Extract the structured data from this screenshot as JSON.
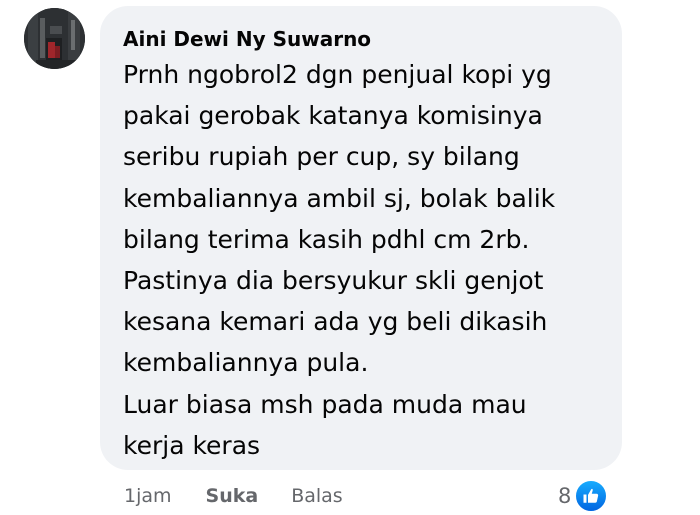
{
  "comment": {
    "author": "Aini Dewi Ny Suwarno",
    "lines": [
      "Prnh ngobrol2 dgn penjual kopi yg",
      "pakai gerobak katanya komisinya",
      "seribu rupiah per cup, sy bilang",
      "kembaliannya ambil sj, bolak balik",
      "bilang terima kasih pdhl cm 2rb.",
      "Pastinya dia bersyukur skli genjot",
      "kesana kemari ada yg beli dikasih",
      "kembaliannya pula.",
      "Luar biasa msh pada muda mau",
      "kerja keras"
    ]
  },
  "actions": {
    "timestamp": "1jam",
    "like_label": "Suka",
    "reply_label": "Balas"
  },
  "reactions": {
    "count": "8",
    "icon": "like-icon",
    "badge_color": "#0866ff"
  },
  "colors": {
    "bubble_bg": "#f0f2f5",
    "text": "#050505",
    "secondary_text": "#65676b"
  }
}
